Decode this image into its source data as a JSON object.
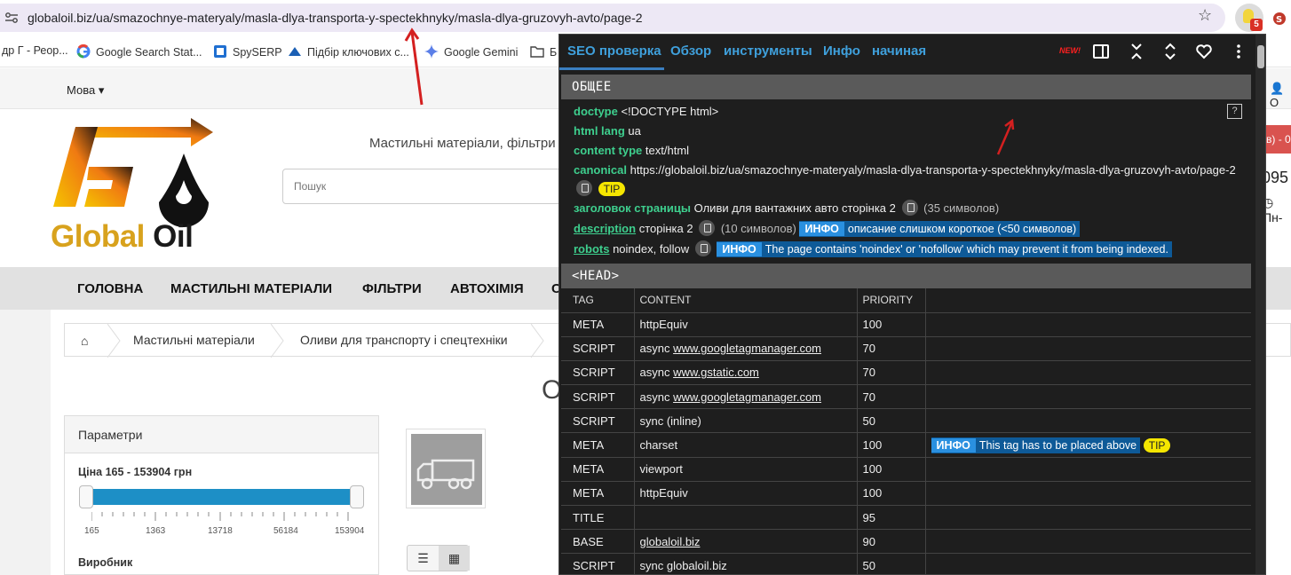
{
  "browser": {
    "url": "globaloil.biz/ua/smazochnye-materyaly/masla-dlya-transporta-y-spectekhnyky/masla-dlya-gruzovyh-avto/page-2",
    "extension_badge": "5",
    "bookmarks": [
      {
        "label": "др Г - Реор...",
        "icon": "folder-icon"
      },
      {
        "label": "Google Search Stat...",
        "icon": "google-icon"
      },
      {
        "label": "SpySERP",
        "icon": "spyserp-icon"
      },
      {
        "label": "Підбір ключових с...",
        "icon": "keywords-icon"
      },
      {
        "label": "Google Gemini",
        "icon": "gemini-icon"
      },
      {
        "label": "Б",
        "icon": "folder-icon"
      }
    ]
  },
  "site": {
    "language_label": "Мова",
    "user_label": "О",
    "logo_text_g": "Global",
    "logo_text_rest": "Oil",
    "tagline": "Мастильні матеріали, фільтри",
    "search_placeholder": "Пошук",
    "cart_label": "в) - 0",
    "phone": "095",
    "phone_line2": "Пн-",
    "menu": [
      "ГОЛОВНА",
      "МАСТИЛЬНІ МАТЕРІАЛИ",
      "ФІЛЬТРИ",
      "АВТОХІМІЯ",
      "С"
    ],
    "breadcrumb": [
      "Мастильні матеріали",
      "Оливи для транспорту і спецтехніки"
    ],
    "page_title_fragment": "О",
    "filters": {
      "title": "Параметри",
      "price_label": "Ціна  165 - 153904 грн",
      "price_ticks": [
        "165",
        "1363",
        "13718",
        "56184",
        "153904"
      ],
      "manufacturer_label": "Виробник"
    }
  },
  "seo_panel": {
    "tabs": [
      "SEO проверка",
      "Обзор",
      "инструменты",
      "Инфо",
      "начиная"
    ],
    "new_badge": "NEW!",
    "general_header": "ОБЩЕЕ",
    "help_icon": "?",
    "general": {
      "doctype_key": "doctype",
      "doctype_val": "<!DOCTYPE html>",
      "lang_key": "html lang",
      "lang_val": "ua",
      "content_type_key": "content type",
      "content_type_val": "text/html",
      "canonical_key": "canonical",
      "canonical_val": "https://globaloil.biz/ua/smazochnye-materyaly/masla-dlya-transporta-y-spectekhnyky/masla-dlya-gruzovyh-avto/page-2",
      "tip": "TIP",
      "title_key": "заголовок страницы",
      "title_val": "Оливи для вантажних авто сторінка 2",
      "title_count": "(35 символов)",
      "desc_key": "description",
      "desc_val": "сторінка 2",
      "desc_count": "(10 символов)",
      "info_label": "ИНФО",
      "desc_info": "описание слишком короткое (<50 символов)",
      "robots_key": "robots",
      "robots_val": "noindex, follow",
      "robots_info": "The page contains 'noindex' or 'nofollow' which may prevent it from being indexed."
    },
    "head_header": "<HEAD>",
    "head_columns": [
      "TAG",
      "CONTENT",
      "PRIORITY"
    ],
    "head_rows": [
      {
        "tag": "META",
        "content": "httpEquiv",
        "link": "",
        "priority": "100",
        "note": ""
      },
      {
        "tag": "SCRIPT",
        "content": "async ",
        "link": "www.googletagmanager.com",
        "priority": "70",
        "note": ""
      },
      {
        "tag": "SCRIPT",
        "content": "async ",
        "link": "www.gstatic.com",
        "priority": "70",
        "note": ""
      },
      {
        "tag": "SCRIPT",
        "content": "async ",
        "link": "www.googletagmanager.com",
        "priority": "70",
        "note": ""
      },
      {
        "tag": "SCRIPT",
        "content": "sync (inline)",
        "link": "",
        "priority": "50",
        "note": ""
      },
      {
        "tag": "META",
        "content": "charset",
        "link": "",
        "priority": "100",
        "note": "This tag has to be placed above"
      },
      {
        "tag": "META",
        "content": "viewport",
        "link": "",
        "priority": "100",
        "note": ""
      },
      {
        "tag": "META",
        "content": "httpEquiv",
        "link": "",
        "priority": "100",
        "note": ""
      },
      {
        "tag": "TITLE",
        "content": "",
        "link": "",
        "priority": "95",
        "note": ""
      },
      {
        "tag": "BASE",
        "content": "",
        "link": "globaloil.biz",
        "priority": "90",
        "note": ""
      },
      {
        "tag": "SCRIPT",
        "content": "sync globaloil.biz",
        "link": "",
        "priority": "50",
        "note": ""
      }
    ]
  },
  "colors": {
    "accent_green": "#3ecf8e",
    "tab_blue": "#3fa0dc",
    "info_blue": "#2a90e0",
    "tip_yellow": "#f5e600",
    "annotation_red": "#d42020"
  }
}
